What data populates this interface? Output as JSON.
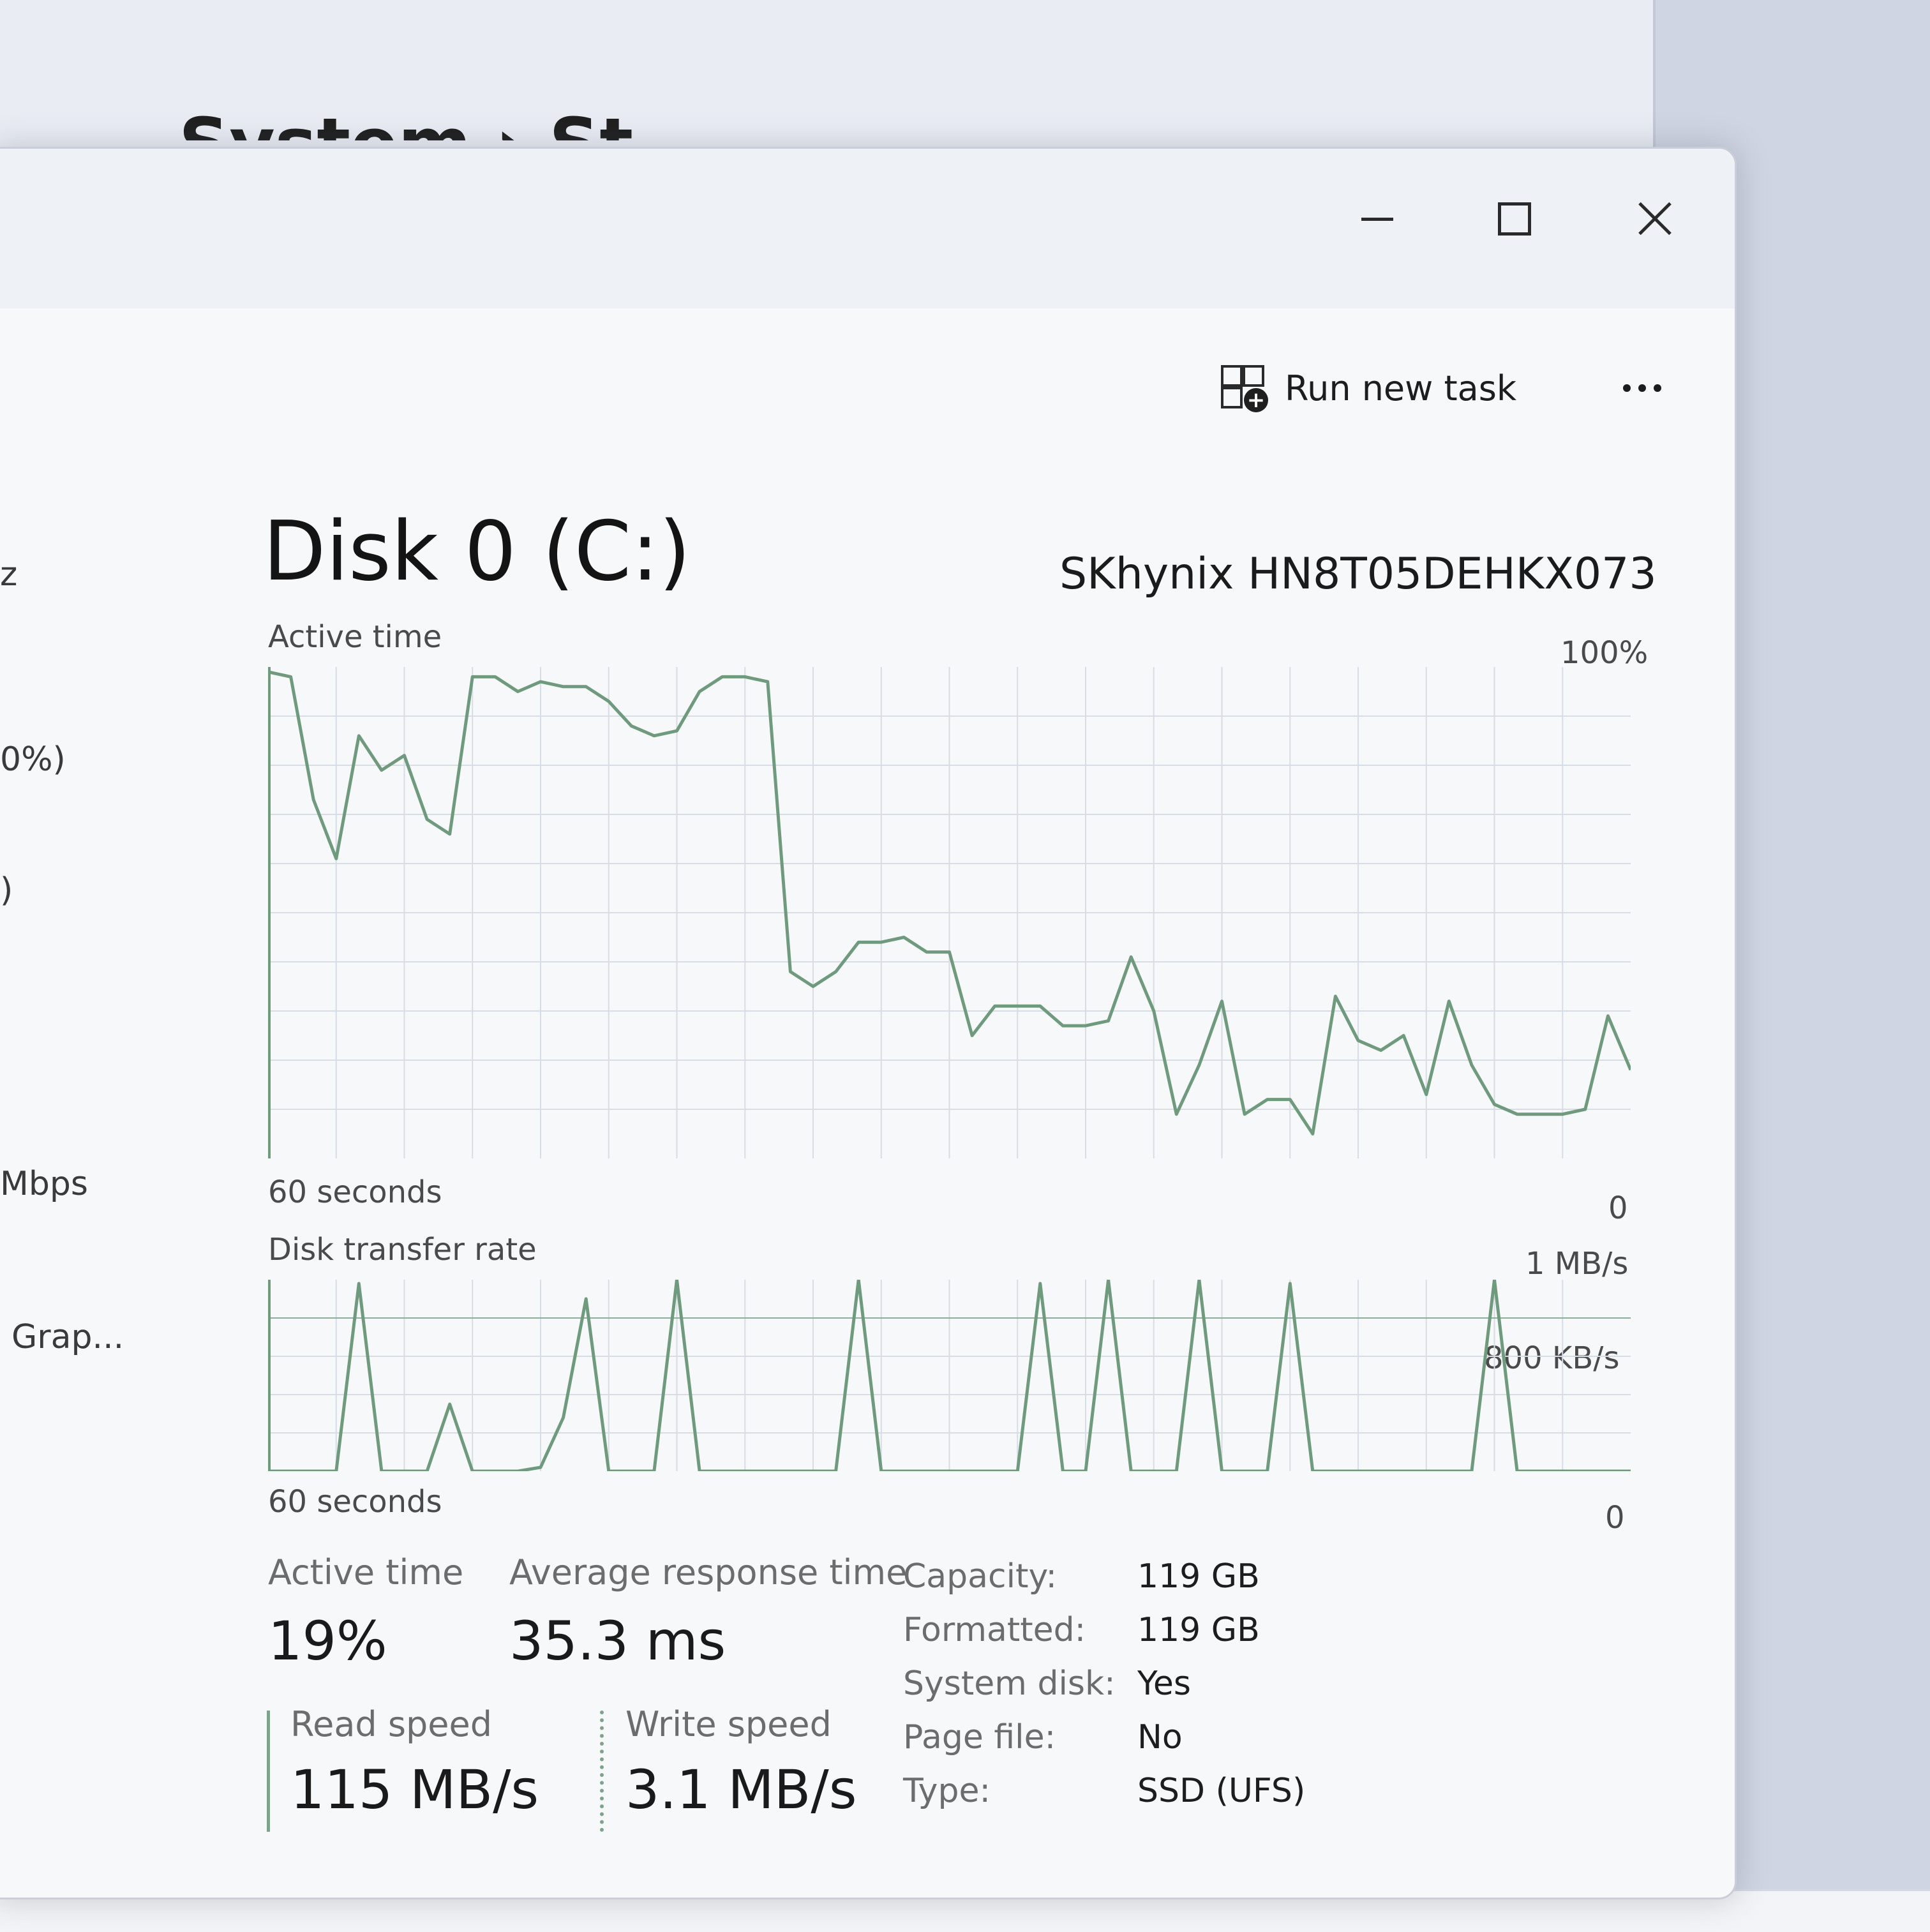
{
  "background": {
    "window_title": "System › St"
  },
  "sidebar": {
    "items": [
      {
        "label": "z"
      },
      {
        "label": "0%)"
      },
      {
        "label": ")"
      },
      {
        "label": "Mbps"
      },
      {
        "label": "Grap..."
      }
    ]
  },
  "toolbar": {
    "run_task_label": "Run new task",
    "more_icon": "more-options-icon"
  },
  "disk": {
    "title": "Disk 0 (C:)",
    "model": "SKhynix HN8T05DEHKX073"
  },
  "charts": {
    "active_time": {
      "label": "Active time",
      "max_label": "100%",
      "min_label": "0",
      "duration_label": "60 seconds"
    },
    "transfer_rate": {
      "label": "Disk transfer rate",
      "max_label": "1 MB/s",
      "mid_label": "800 KB/s",
      "min_label": "0",
      "duration_label": "60 seconds"
    }
  },
  "chart_data": [
    {
      "type": "line",
      "title": "Active time",
      "ylim": [
        0,
        100
      ],
      "x": [
        0,
        1,
        2,
        3,
        4,
        5,
        6,
        7,
        8,
        9,
        10,
        11,
        12,
        13,
        14,
        15,
        16,
        17,
        18,
        19,
        20,
        21,
        22,
        23,
        24,
        25,
        26,
        27,
        28,
        29,
        30,
        31,
        32,
        33,
        34,
        35,
        36,
        37,
        38,
        39,
        40,
        41,
        42,
        43,
        44,
        45,
        46,
        47,
        48,
        49,
        50,
        51,
        52,
        53,
        54,
        55,
        56,
        57,
        58,
        59,
        60
      ],
      "values": [
        99,
        98,
        73,
        61,
        86,
        79,
        82,
        69,
        66,
        98,
        98,
        95,
        97,
        96,
        96,
        93,
        88,
        86,
        87,
        95,
        98,
        98,
        97,
        38,
        35,
        38,
        44,
        44,
        45,
        42,
        42,
        25,
        31,
        31,
        31,
        27,
        27,
        28,
        41,
        30,
        9,
        19,
        32,
        9,
        12,
        12,
        5,
        33,
        24,
        22,
        25,
        13,
        32,
        19,
        11,
        9,
        9,
        9,
        10,
        29,
        18
      ]
    },
    {
      "type": "line",
      "title": "Disk transfer rate",
      "ylim": [
        0,
        1000
      ],
      "x": [
        0,
        1,
        2,
        3,
        4,
        5,
        6,
        7,
        8,
        9,
        10,
        11,
        12,
        13,
        14,
        15,
        16,
        17,
        18,
        19,
        20,
        21,
        22,
        23,
        24,
        25,
        26,
        27,
        28,
        29,
        30,
        31,
        32,
        33,
        34,
        35,
        36,
        37,
        38,
        39,
        40,
        41,
        42,
        43,
        44,
        45,
        46,
        47,
        48,
        49,
        50,
        51,
        52,
        53,
        54,
        55,
        56,
        57,
        58,
        59,
        60
      ],
      "values": [
        0,
        0,
        0,
        0,
        980,
        0,
        0,
        0,
        350,
        0,
        0,
        0,
        20,
        280,
        900,
        0,
        0,
        0,
        1000,
        0,
        0,
        0,
        0,
        0,
        0,
        0,
        1000,
        0,
        0,
        0,
        0,
        0,
        0,
        0,
        980,
        0,
        0,
        1000,
        0,
        0,
        0,
        1000,
        0,
        0,
        0,
        980,
        0,
        0,
        0,
        0,
        0,
        0,
        0,
        0,
        1000,
        0,
        0,
        0,
        0,
        0,
        0
      ]
    }
  ],
  "stats": {
    "active_time": {
      "label": "Active time",
      "value": "19%"
    },
    "avg_response": {
      "label": "Average response time",
      "value": "35.3 ms"
    },
    "read_speed": {
      "label": "Read speed",
      "value": "115 MB/s"
    },
    "write_speed": {
      "label": "Write speed",
      "value": "3.1 MB/s"
    }
  },
  "properties": [
    {
      "label": "Capacity:",
      "value": "119 GB"
    },
    {
      "label": "Formatted:",
      "value": "119 GB"
    },
    {
      "label": "System disk:",
      "value": "Yes"
    },
    {
      "label": "Page file:",
      "value": "No"
    },
    {
      "label": "Type:",
      "value": "SSD (UFS)"
    }
  ],
  "colors": {
    "graph_line": "#6f9a7e",
    "graph_grid": "#d6dde4",
    "graph_border": "#6f9a7e"
  }
}
